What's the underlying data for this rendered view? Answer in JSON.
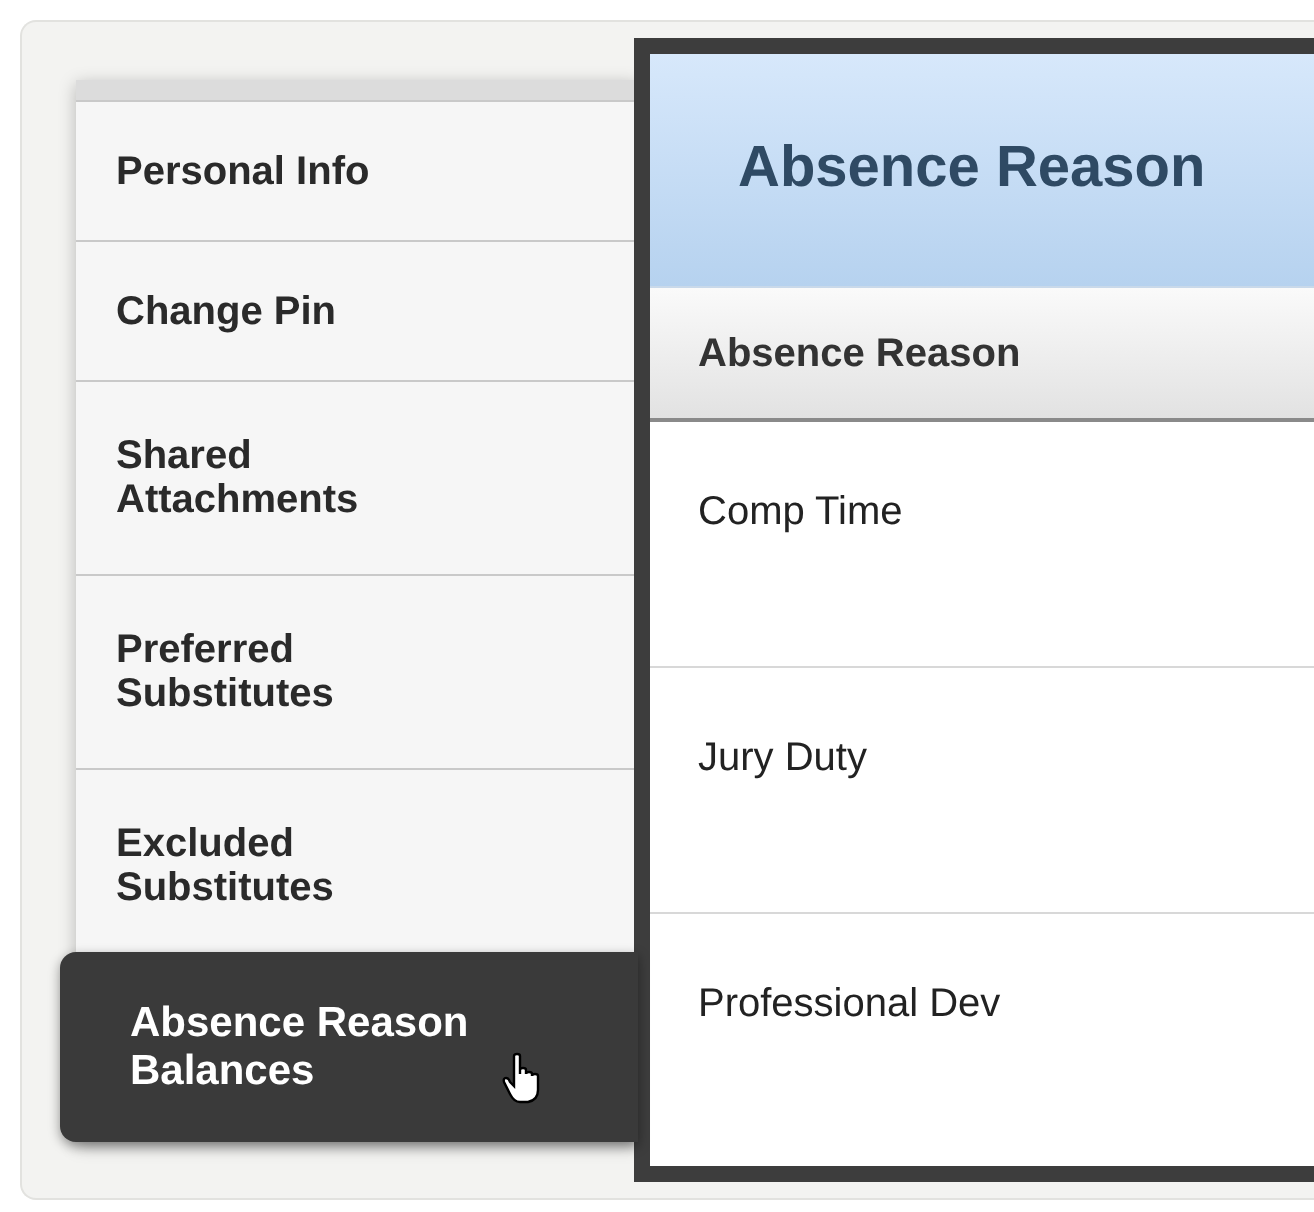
{
  "sidebar": {
    "items": [
      {
        "label": "Personal Info",
        "selected": false
      },
      {
        "label": "Change Pin",
        "selected": false
      },
      {
        "label": "Shared Attachments",
        "selected": false
      },
      {
        "label": "Preferred Substitutes",
        "selected": false
      },
      {
        "label": "Excluded Substitutes",
        "selected": false
      },
      {
        "label": "Absence Reason Balances",
        "selected": true
      }
    ]
  },
  "dialog": {
    "title": "Absence Reason",
    "table": {
      "columns": [
        "Absence Reason"
      ],
      "rows": [
        [
          "Comp Time"
        ],
        [
          "Jury Duty"
        ],
        [
          "Professional Dev"
        ]
      ]
    }
  }
}
